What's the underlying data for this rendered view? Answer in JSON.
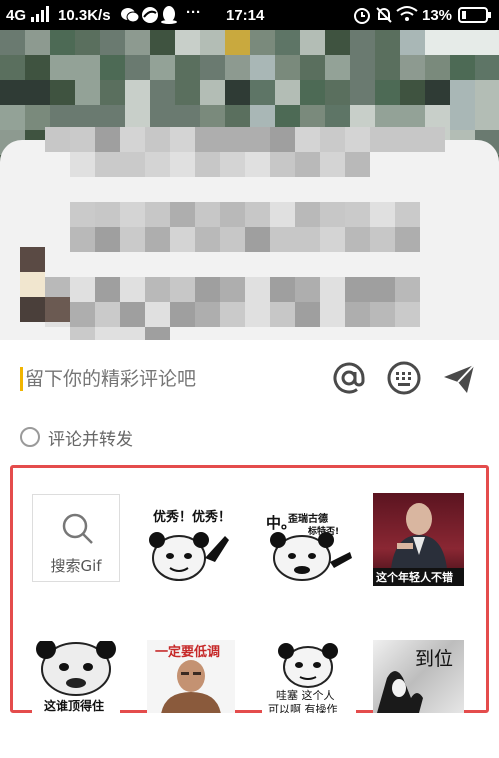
{
  "status_bar": {
    "network": "4G",
    "speed": "10.3K/s",
    "time": "17:14",
    "battery": "13%",
    "more": "···"
  },
  "comment": {
    "placeholder": "留下你的精彩评论吧",
    "mention_icon": "at-icon",
    "emoji_icon": "keyboard-emoji-icon",
    "send_icon": "send-icon"
  },
  "repost": {
    "label": "评论并转发",
    "checked": false
  },
  "gif_panel": {
    "search_label": "搜索Gif",
    "items": [
      {
        "caption": "优秀！优秀！"
      },
      {
        "caption_main": "中。",
        "caption_sub": "歪瑞古德",
        "caption_sub2": "标特否!"
      },
      {
        "caption": "这个年轻人不错"
      },
      {
        "caption": "这谁顶得住"
      },
      {
        "caption": "一定要低调"
      },
      {
        "caption_line1": "哇塞 这个人",
        "caption_line2": "可以啊 有操作"
      },
      {
        "caption": "到位"
      }
    ]
  },
  "colors": {
    "highlight_border": "#e44c4c",
    "cursor": "#f1b500"
  }
}
